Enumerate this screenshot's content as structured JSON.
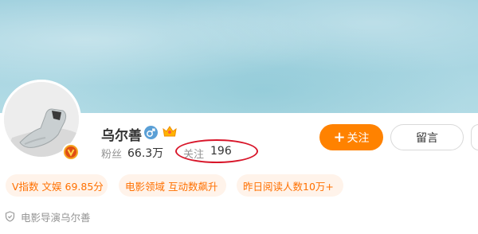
{
  "profile": {
    "name": "乌尔善",
    "gender_icon": "male-icon",
    "member_icon": "crown-icon",
    "verified_badge": "v-badge-icon",
    "fans_label": "粉丝",
    "fans_count": "66.3万",
    "follow_label": "关注",
    "follow_count": "196",
    "verification_text": "电影导演乌尔善"
  },
  "actions": {
    "follow_plus": "+",
    "follow_label": "关注",
    "message_label": "留言"
  },
  "tags": [
    {
      "label": "V指数 文娱 69.85分"
    },
    {
      "label": "电影领域 互动数飙升"
    },
    {
      "label": "昨日阅读人数10万+"
    }
  ],
  "colors": {
    "accent": "#ff8200",
    "tag_bg": "#fff3ea",
    "tag_text": "#ff7000",
    "highlight": "#d8162a",
    "banner": "#a9d6e2"
  }
}
